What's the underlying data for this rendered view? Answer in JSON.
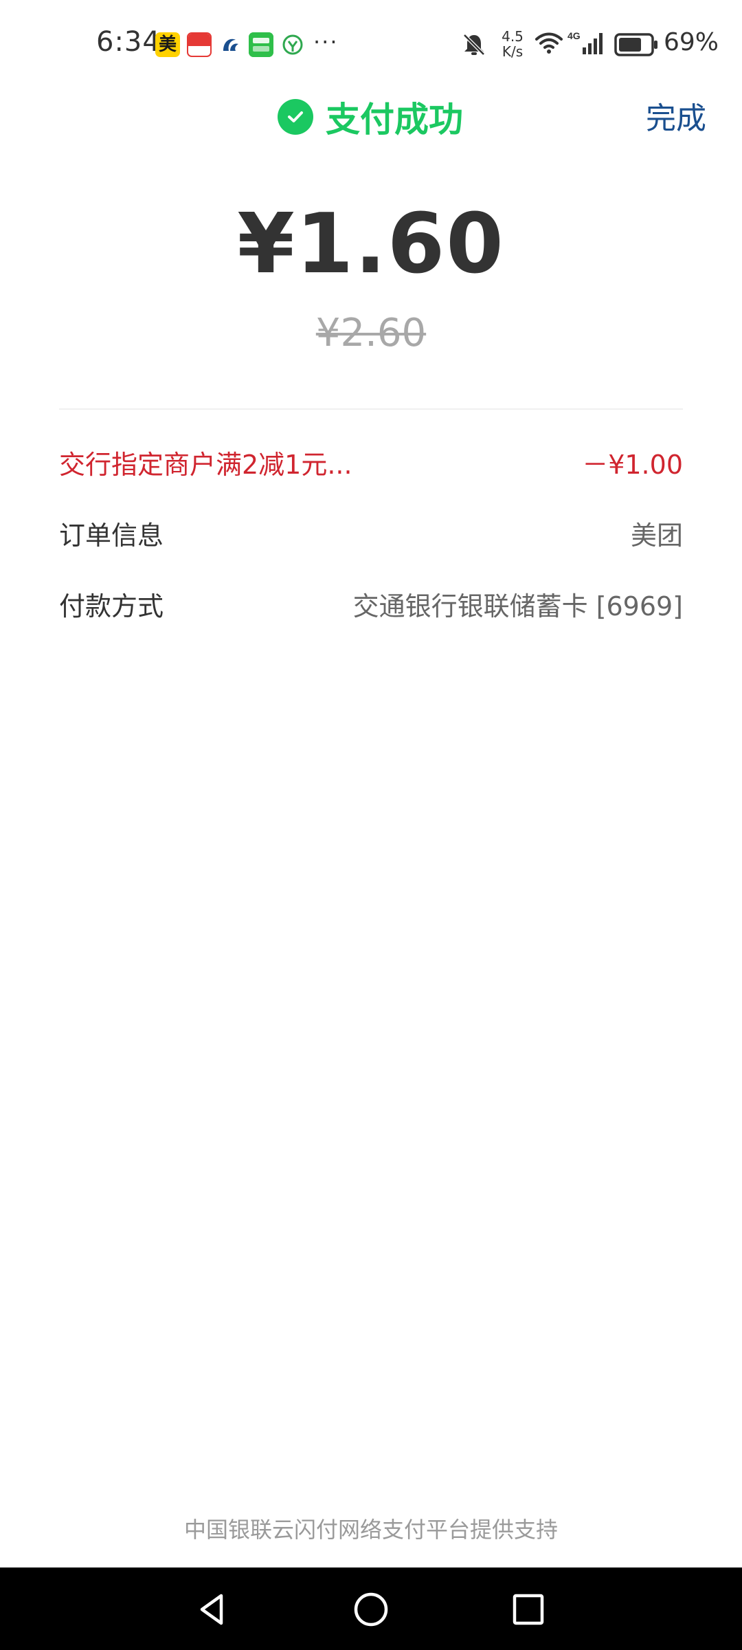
{
  "status_bar": {
    "time": "6:34",
    "app_icons": [
      "meituan-icon",
      "pay-app-icon",
      "bank-app-icon",
      "iqiyi-icon",
      "green-circle-app-icon"
    ],
    "meituan_glyph": "美",
    "more": "···",
    "net_speed_value": "4.5",
    "net_speed_unit": "K/s",
    "network_type": "4G",
    "battery_percent": "69%"
  },
  "header": {
    "title": "支付成功",
    "done_label": "完成",
    "accent_color": "#1bc861",
    "link_color": "#1a4f8f"
  },
  "payment": {
    "amount_paid": "¥1.60",
    "amount_original": "¥2.60"
  },
  "details": [
    {
      "label": "交行指定商户满2减1元...",
      "value": "－¥1.00",
      "highlight": true,
      "color": "#d0252f"
    },
    {
      "label": "订单信息",
      "value": "美团",
      "highlight": false
    },
    {
      "label": "付款方式",
      "value": "交通银行银联储蓄卡 [6969]",
      "highlight": false
    }
  ],
  "footer": {
    "text": "中国银联云闪付网络支付平台提供支持"
  },
  "nav_bar": {
    "buttons": [
      "back-icon",
      "home-icon",
      "recents-icon"
    ]
  }
}
